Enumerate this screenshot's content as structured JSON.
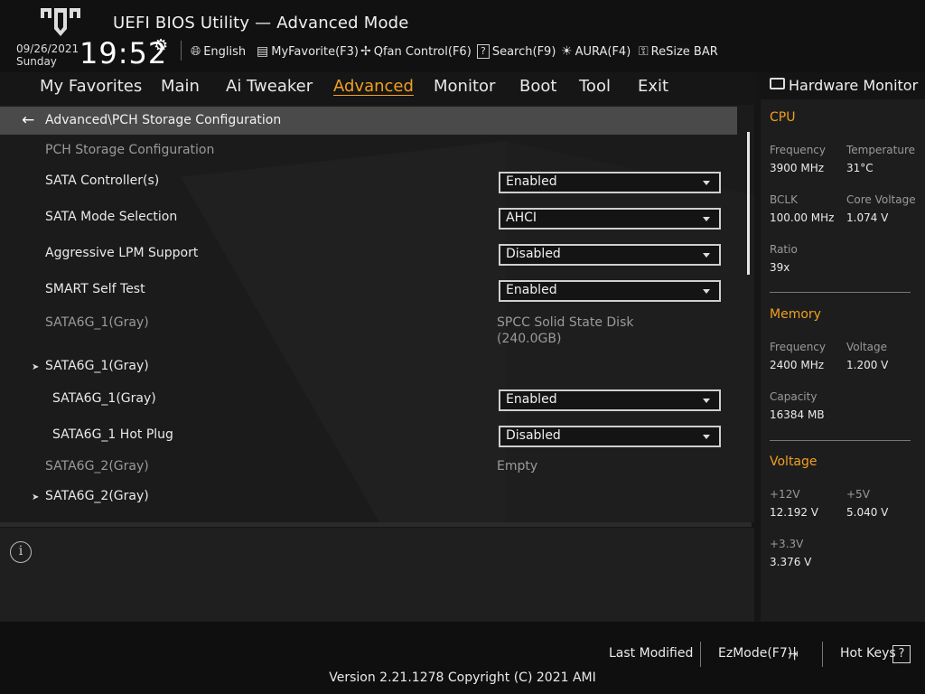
{
  "header": {
    "title": "UEFI BIOS Utility — Advanced Mode",
    "date": "09/26/2021",
    "day": "Sunday",
    "time": "19:52",
    "tools": [
      {
        "label": "English",
        "icon": "globe-icon"
      },
      {
        "label": "MyFavorite(F3)",
        "icon": "favorite-icon"
      },
      {
        "label": "Qfan Control(F6)",
        "icon": "fan-icon"
      },
      {
        "label": "Search(F9)",
        "icon": "search-icon"
      },
      {
        "label": "AURA(F4)",
        "icon": "aura-icon"
      },
      {
        "label": "ReSize BAR",
        "icon": "resize-bar-icon"
      }
    ]
  },
  "nav": {
    "tabs": [
      "My Favorites",
      "Main",
      "Ai Tweaker",
      "Advanced",
      "Monitor",
      "Boot",
      "Tool",
      "Exit"
    ],
    "active": "Advanced"
  },
  "content": {
    "breadcrumb": "Advanced\\PCH Storage Configuration",
    "section_title": "PCH Storage Configuration",
    "rows": [
      {
        "label": "SATA Controller(s)",
        "value": "Enabled"
      },
      {
        "label": "SATA Mode Selection",
        "value": "AHCI"
      },
      {
        "label": "Aggressive LPM Support",
        "value": "Disabled"
      },
      {
        "label": "SMART Self Test",
        "value": "Enabled"
      },
      {
        "label": "SATA6G_1(Gray)",
        "info_line1": "SPCC Solid State Disk",
        "info_line2": "(240.0GB)"
      },
      {
        "label": "SATA6G_1(Gray)"
      },
      {
        "label": "SATA6G_1(Gray)",
        "value": "Enabled"
      },
      {
        "label": "SATA6G_1 Hot Plug",
        "value": "Disabled"
      },
      {
        "label": "SATA6G_2(Gray)",
        "info": "Empty"
      },
      {
        "label": "SATA6G_2(Gray)"
      }
    ]
  },
  "hardware_monitor": {
    "title": "Hardware Monitor",
    "cpu": {
      "heading": "CPU",
      "frequency_label": "Frequency",
      "frequency": "3900 MHz",
      "temperature_label": "Temperature",
      "temperature": "31°C",
      "bclk_label": "BCLK",
      "bclk": "100.00 MHz",
      "core_voltage_label": "Core Voltage",
      "core_voltage": "1.074 V",
      "ratio_label": "Ratio",
      "ratio": "39x"
    },
    "memory": {
      "heading": "Memory",
      "frequency_label": "Frequency",
      "frequency": "2400 MHz",
      "voltage_label": "Voltage",
      "voltage": "1.200 V",
      "capacity_label": "Capacity",
      "capacity": "16384 MB"
    },
    "voltage": {
      "heading": "Voltage",
      "v12_label": "+12V",
      "v12": "12.192 V",
      "v5_label": "+5V",
      "v5": "5.040 V",
      "v33_label": "+3.3V",
      "v33": "3.376 V"
    }
  },
  "footer": {
    "last_modified": "Last Modified",
    "ezmode": "EzMode(F7)|",
    "hot_keys": "Hot Keys",
    "hot_keys_icon": "?",
    "version": "Version 2.21.1278 Copyright (C) 2021 AMI"
  },
  "colors": {
    "accent": "#f0a020",
    "breadcrumb_bg": "#4a4a4a"
  }
}
